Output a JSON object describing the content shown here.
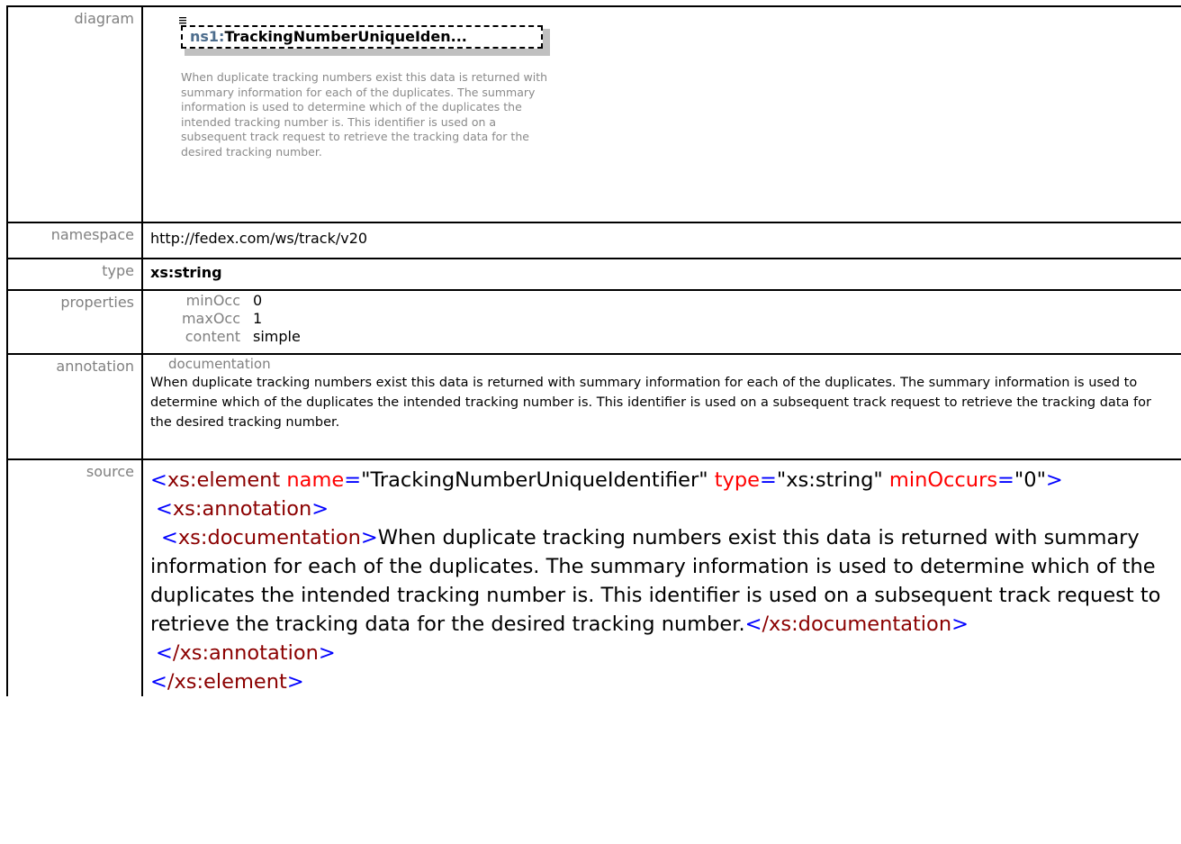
{
  "rows": {
    "diagram": {
      "label": "diagram",
      "element_prefix": "ns1:",
      "element_name": "TrackingNumberUniqueIden...",
      "documentation": "When duplicate tracking numbers exist this data is returned with summary information for each of the duplicates. The summary information is used to determine which of the duplicates the intended tracking number is. This identifier is used on a subsequent track request to retrieve the tracking data for the desired tracking number."
    },
    "namespace": {
      "label": "namespace",
      "value": "http://fedex.com/ws/track/v20"
    },
    "type": {
      "label": "type",
      "value": "xs:string"
    },
    "properties": {
      "label": "properties",
      "items": [
        {
          "key": "minOcc",
          "value": "0"
        },
        {
          "key": "maxOcc",
          "value": "1"
        },
        {
          "key": "content",
          "value": "simple"
        }
      ]
    },
    "annotation": {
      "label": "annotation",
      "heading": "documentation",
      "text": "When duplicate  tracking numbers exist this data is returned with summary information for each of the duplicates. The summary information is used to determine which of the duplicates the intended tracking number is. This identifier is used on a subsequent track request to retrieve the tracking data for the desired tracking number."
    },
    "source": {
      "label": "source",
      "element_tag": "xs:element",
      "name_attr": "name",
      "name_value": "\"TrackingNumberUniqueIdentifier\"",
      "type_attr": "type",
      "type_value": "\"xs:string\"",
      "minoccurs_attr": "minOccurs",
      "minoccurs_value": "\"0\"",
      "annotation_tag": "xs:annotation",
      "documentation_tag": "xs:documentation",
      "documentation_text": "When duplicate tracking numbers exist this data is returned with summary information for each of the duplicates. The summary information is used to determine which of the duplicates the intended tracking number is. This identifier is used on a subsequent track request to retrieve the tracking data for the desired tracking number.",
      "close_documentation_tag": "/xs:documentation",
      "close_annotation_tag": "/xs:annotation",
      "close_element_tag": "/xs:element"
    }
  },
  "colors": {
    "tag": "#8b0000",
    "punctuation": "#0000ff",
    "attribute": "#ff0000",
    "label": "#808080",
    "heading": "#4b2a9a"
  }
}
